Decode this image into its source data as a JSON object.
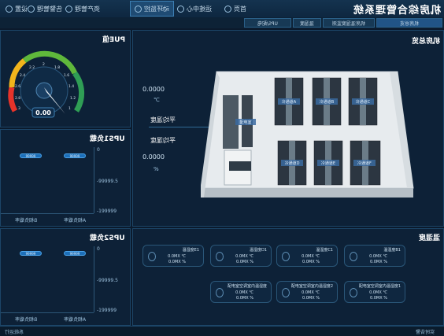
{
  "app": {
    "title": "机房综合管理系统"
  },
  "nav": {
    "items": [
      {
        "label": "首页",
        "icon": "home-icon"
      },
      {
        "label": "运维中心",
        "icon": "wrench-icon"
      },
      {
        "label": "动环监控",
        "icon": "monitor-icon",
        "active": true
      },
      {
        "label": "资产管理",
        "icon": "database-icon"
      },
      {
        "label": "告警管理",
        "icon": "alarm-icon"
      },
      {
        "label": "设置",
        "icon": "gear-icon"
      }
    ]
  },
  "subtabs": [
    "温湿度",
    "UPS/配电",
    "机房温湿度监测",
    "机房总览"
  ],
  "overview": {
    "title": "机房总览",
    "avg_temp_label": "平均温度",
    "avg_temp_value": "0000.0",
    "avg_temp_unit": "℃",
    "avg_hum_label": "平均湿度",
    "avg_hum_value": "0000.0",
    "avg_hum_unit": "%",
    "room_labels": [
      "冷通道A",
      "冷通道B",
      "冷通道C",
      "冷通道D",
      "冷通道E",
      "冷通道F",
      "配电室"
    ]
  },
  "pue": {
    "title": "PUE值",
    "value": "0.00",
    "ticks": [
      "1",
      "1.2",
      "1.4",
      "1.6",
      "1.8",
      "2",
      "2.2",
      "2.4",
      "2.6",
      "2.8",
      "3"
    ]
  },
  "ups1": {
    "title": "UPS1负载",
    "series": [
      "A相负载率",
      "B相负载率"
    ],
    "pill_values": [
      "99999",
      "99999"
    ],
    "ticks": [
      "0",
      "-99999.5",
      "-199999"
    ]
  },
  "ups2": {
    "title": "UPS2负载",
    "series": [
      "A相负载率",
      "B相负载率"
    ],
    "pill_values": [
      "99999",
      "99999"
    ],
    "ticks": [
      "0",
      "-99999.5",
      "-199999"
    ]
  },
  "sensors": {
    "title": "温湿度",
    "cards": [
      {
        "name": "温湿度B1",
        "t": "0.0MX ℃",
        "h": "0.0MX %"
      },
      {
        "name": "温湿度C1",
        "t": "0.0MX ℃",
        "h": "0.0MX %"
      },
      {
        "name": "温湿度D1",
        "t": "0.0MX ℃",
        "h": "0.0MX %"
      },
      {
        "name": "温湿度E1",
        "t": "0.0MX ℃",
        "h": "0.0MX %"
      },
      {
        "name": "配电室空调室内温湿度1",
        "t": "0.0MX ℃",
        "h": "0.0MX %"
      },
      {
        "name": "配电室空调室内温湿度2",
        "t": "0.0MX ℃",
        "h": "0.0MX %"
      },
      {
        "name": "配电室空调室内温湿度",
        "t": "0.0MX ℃",
        "h": "0.0MX %"
      }
    ]
  },
  "status": {
    "left": "系统运行",
    "right": "实时告警"
  }
}
